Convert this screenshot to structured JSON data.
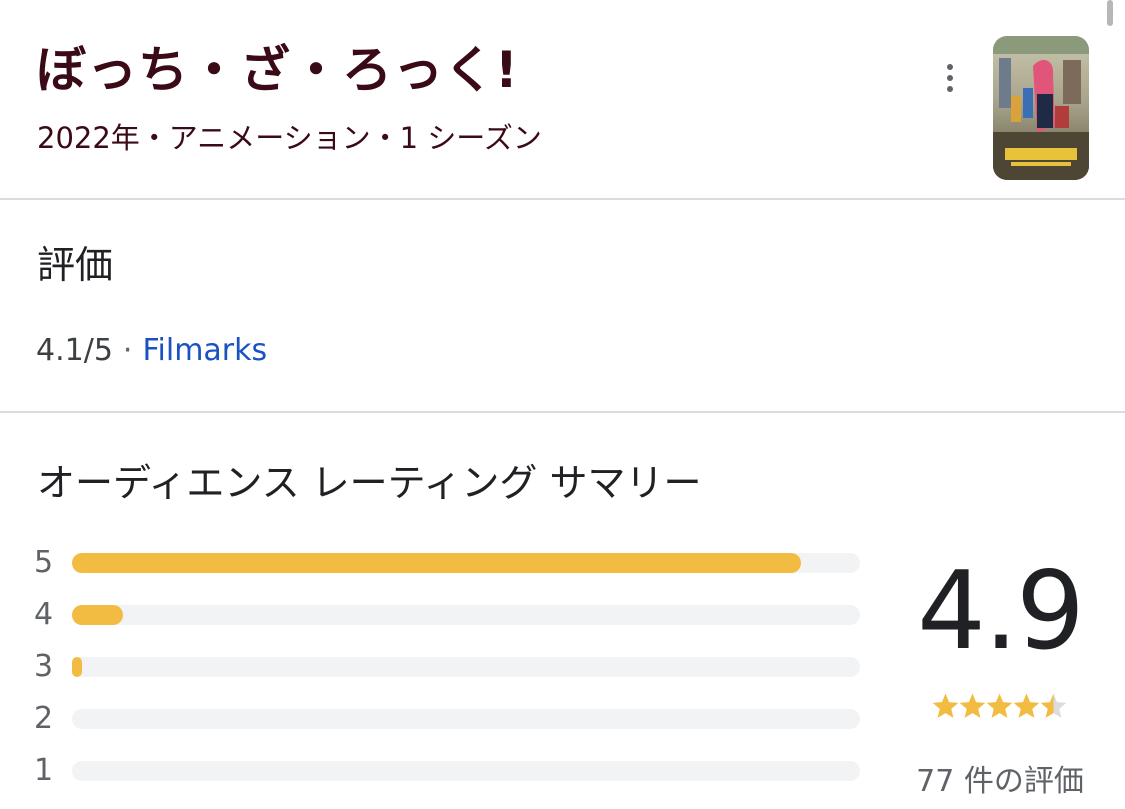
{
  "header": {
    "title": "ぼっち・ざ・ろっく!",
    "subtitle": "2022年・アニメーション・1 シーズン",
    "more_icon": "more-vert-icon",
    "poster_icon": "poster-thumbnail"
  },
  "rating_section": {
    "heading": "評価",
    "score": "4.1/5",
    "separator": "·",
    "source": "Filmarks"
  },
  "audience_section": {
    "heading": "オーディエンス レーティング サマリー",
    "distribution": [
      {
        "label": "5",
        "fraction": 0.925
      },
      {
        "label": "4",
        "fraction": 0.065
      },
      {
        "label": "3",
        "fraction": 0.013
      },
      {
        "label": "2",
        "fraction": 0
      },
      {
        "label": "1",
        "fraction": 0
      }
    ],
    "average": "4.9",
    "stars_value": 4.5,
    "review_count": "77 件の評価"
  },
  "colors": {
    "title": "#3a0a16",
    "link": "#1a52c2",
    "bar_fill": "#f2bc42",
    "bar_track": "#f1f3f4",
    "star": "#f2bc42",
    "star_empty": "#dadce0"
  }
}
